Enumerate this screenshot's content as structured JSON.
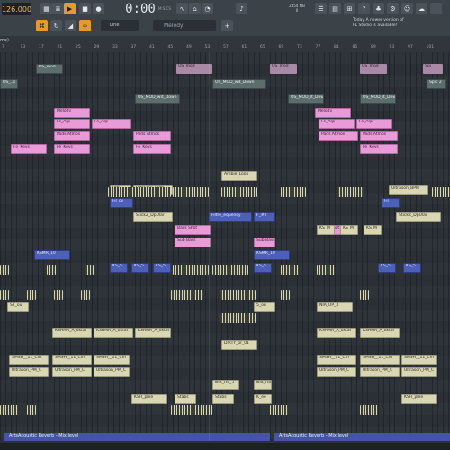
{
  "toolbar": {
    "bpm": "126.000",
    "clock": "0:00",
    "clock_sub": "M:S:CS",
    "memory": "2454 MB",
    "memory_sub": "0",
    "pattern": "Melody",
    "line": "Line",
    "news_line1": "Today  A newer version of",
    "news_line2": "FL Studio is available!"
  },
  "tab_name": "me)",
  "ruler": [
    "7",
    "13",
    "17",
    "21",
    "25",
    "29",
    "33",
    "37",
    "41",
    "45",
    "49",
    "53",
    "57",
    "61",
    "65",
    "69",
    "73",
    "77",
    "81",
    "85",
    "89",
    "93",
    "97",
    "101"
  ],
  "clips": {
    "os_mod": "OS_mod",
    "os_mod2": "OS_mod",
    "os_mod_right": "OS_mod",
    "os_mod_right2": "OS_mod",
    "spi": "Spi",
    "spic2": "Spic 2",
    "os_1": "OS_..1",
    "os_mod_dow": "OS_MOD_wit_Down",
    "os_mod_dow2": "OS_MOD_wit_Down",
    "os_mod_dow3": "OS_MOD_it_Down",
    "os_mod_dow4": "OS_MOD_it_Down",
    "melody1": "Melody",
    "melody2": "Melody",
    "arp1": "Fe_Arp",
    "arp2": "Fe_Arp",
    "arp3": "Fe_Arp",
    "arp4": "Fe_Arp",
    "pads1": "Pads Atmos",
    "pads2": "Pads Atmos",
    "pads3": "Pads Atmos",
    "pads4": "Pads Atmos",
    "keys1": "Fe_Keys",
    "keys2": "Fe_Keys",
    "keys3": "Fe_Keys",
    "keys4": "Fe_Keys",
    "ambie": "Ambie_Loop",
    "ultr1": "Ultr",
    "ultras1": "Ultrason_BPM",
    "ultras2": "Ultrason_BPM",
    "fil1": "Fil_cy",
    "fil2": "Fil",
    "stick1": "StickZ_DpUlar",
    "stick2": "StickZ_DpUlar",
    "filtre": "Filtre_equency",
    "f2": "F_#2",
    "bass1": "Bass Shot",
    "bass2": "Bass Shot",
    "sub1": "Sub Bass",
    "sub2": "Sub Bass",
    "ks1": "KS_M",
    "ks2": "KS_M",
    "ks3": "KS_M",
    "ksmr": "KSMR_10",
    "ksmr2": "KSMR_10",
    "ks5a": "KS_5",
    "ks5b": "KS_5",
    "ks5c": "KS_5",
    "ks5d": "KS_5",
    "ks5e": "KS_5",
    "ks5f": "KS_5",
    "st": "ST_ou",
    "s5": "5_ou",
    "nia1": "NIA_UP_3",
    "nia2": "NIA_UP_3",
    "nia3": "NIA_UP_3",
    "kshmr1": "KSHMR_A_oxtal",
    "kshmr2": "KSHMR_A_oxtal",
    "kshmr3": "KSHMR_A_oxtal",
    "kshmr4": "KSHMR_A_oxtal",
    "kshmr5": "KSHMR_A_oxtal",
    "dirty": "DIRTY_or_01",
    "smsh1": "SMSH__11_Cm",
    "smsh2": "SMSH__11_Cm",
    "smsh3": "SMSH__11_Cm",
    "smsh4": "SMSH__11_Cm",
    "smsh5": "SMSH__11_Cm",
    "smsh6": "SMSH__11_Cm",
    "upm1": "Ultrason_PM_C",
    "upm2": "Ultrason_PM_C",
    "upm3": "Ultrason_PM_C",
    "upm4": "Ultrason_PM_C",
    "upm5": "Ultrason_PM_C",
    "upm6": "Ultrason_PM_C",
    "nia_bot": "NIA_UP",
    "nia_bot2": "NIA_UP",
    "ksh1": "KSH_plee",
    "ksh2": "KSH_plee",
    "stabs": "Stabs",
    "stabs2": "Stabs",
    "kee": "K_ee"
  },
  "automation": {
    "label1": "ArtsAcoustic Reverb - Mix level",
    "label2": "ArtsAcoustic Reverb - Mix level"
  }
}
